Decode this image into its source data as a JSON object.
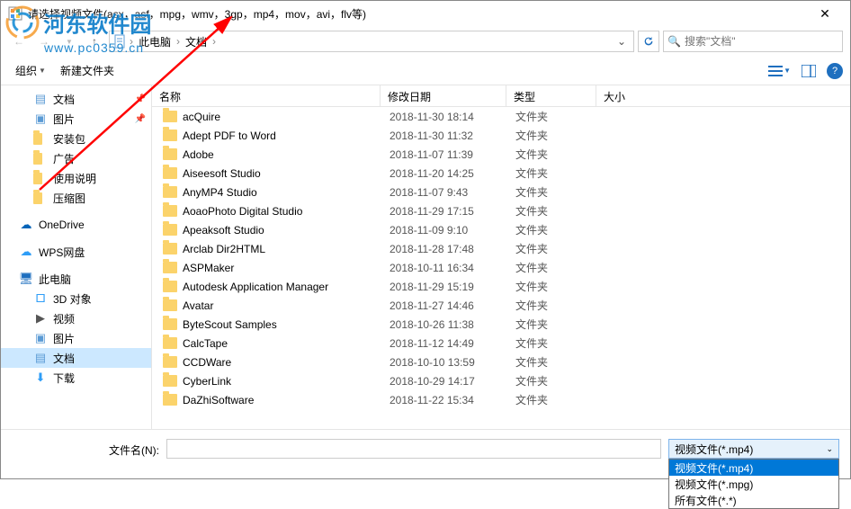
{
  "title": "请选择视频文件(asx，asf，mpg，wmv，3gp，mp4，mov，avi，flv等)",
  "watermark": {
    "text": "河东软件园",
    "url": "www.pc0359.cn"
  },
  "breadcrumb": {
    "pc": "此电脑",
    "docs": "文档"
  },
  "search": {
    "placeholder": "搜索\"文档\""
  },
  "toolbar": {
    "organize": "组织",
    "newfolder": "新建文件夹"
  },
  "columns": {
    "name": "名称",
    "date": "修改日期",
    "type": "类型",
    "size": "大小"
  },
  "sidebar": {
    "docs": "文档",
    "pics": "图片",
    "pkg": "安装包",
    "ads": "广告",
    "manual": "使用说明",
    "zip": "压缩图",
    "onedrive": "OneDrive",
    "wps": "WPS网盘",
    "thispc": "此电脑",
    "obj3d": "3D 对象",
    "video": "视频",
    "pics2": "图片",
    "docs2": "文档",
    "download": "下载"
  },
  "folder_type": "文件夹",
  "files": [
    {
      "name": "acQuire",
      "date": "2018-11-30 18:14"
    },
    {
      "name": "Adept PDF to Word",
      "date": "2018-11-30 11:32"
    },
    {
      "name": "Adobe",
      "date": "2018-11-07 11:39"
    },
    {
      "name": "Aiseesoft Studio",
      "date": "2018-11-20 14:25"
    },
    {
      "name": "AnyMP4 Studio",
      "date": "2018-11-07 9:43"
    },
    {
      "name": "AoaoPhoto Digital Studio",
      "date": "2018-11-29 17:15"
    },
    {
      "name": "Apeaksoft Studio",
      "date": "2018-11-09 9:10"
    },
    {
      "name": "Arclab Dir2HTML",
      "date": "2018-11-28 17:48"
    },
    {
      "name": "ASPMaker",
      "date": "2018-10-11 16:34"
    },
    {
      "name": "Autodesk Application Manager",
      "date": "2018-11-29 15:19"
    },
    {
      "name": "Avatar",
      "date": "2018-11-27 14:46"
    },
    {
      "name": "ByteScout Samples",
      "date": "2018-10-26 11:38"
    },
    {
      "name": "CalcTape",
      "date": "2018-11-12 14:49"
    },
    {
      "name": "CCDWare",
      "date": "2018-10-10 13:59"
    },
    {
      "name": "CyberLink",
      "date": "2018-10-29 14:17"
    },
    {
      "name": "DaZhiSoftware",
      "date": "2018-11-22 15:34"
    }
  ],
  "bottom": {
    "label": "文件名(N):",
    "selected": "视频文件(*.mp4)",
    "options": [
      "视频文件(*.mp4)",
      "视频文件(*.mpg)",
      "所有文件(*.*)"
    ]
  }
}
